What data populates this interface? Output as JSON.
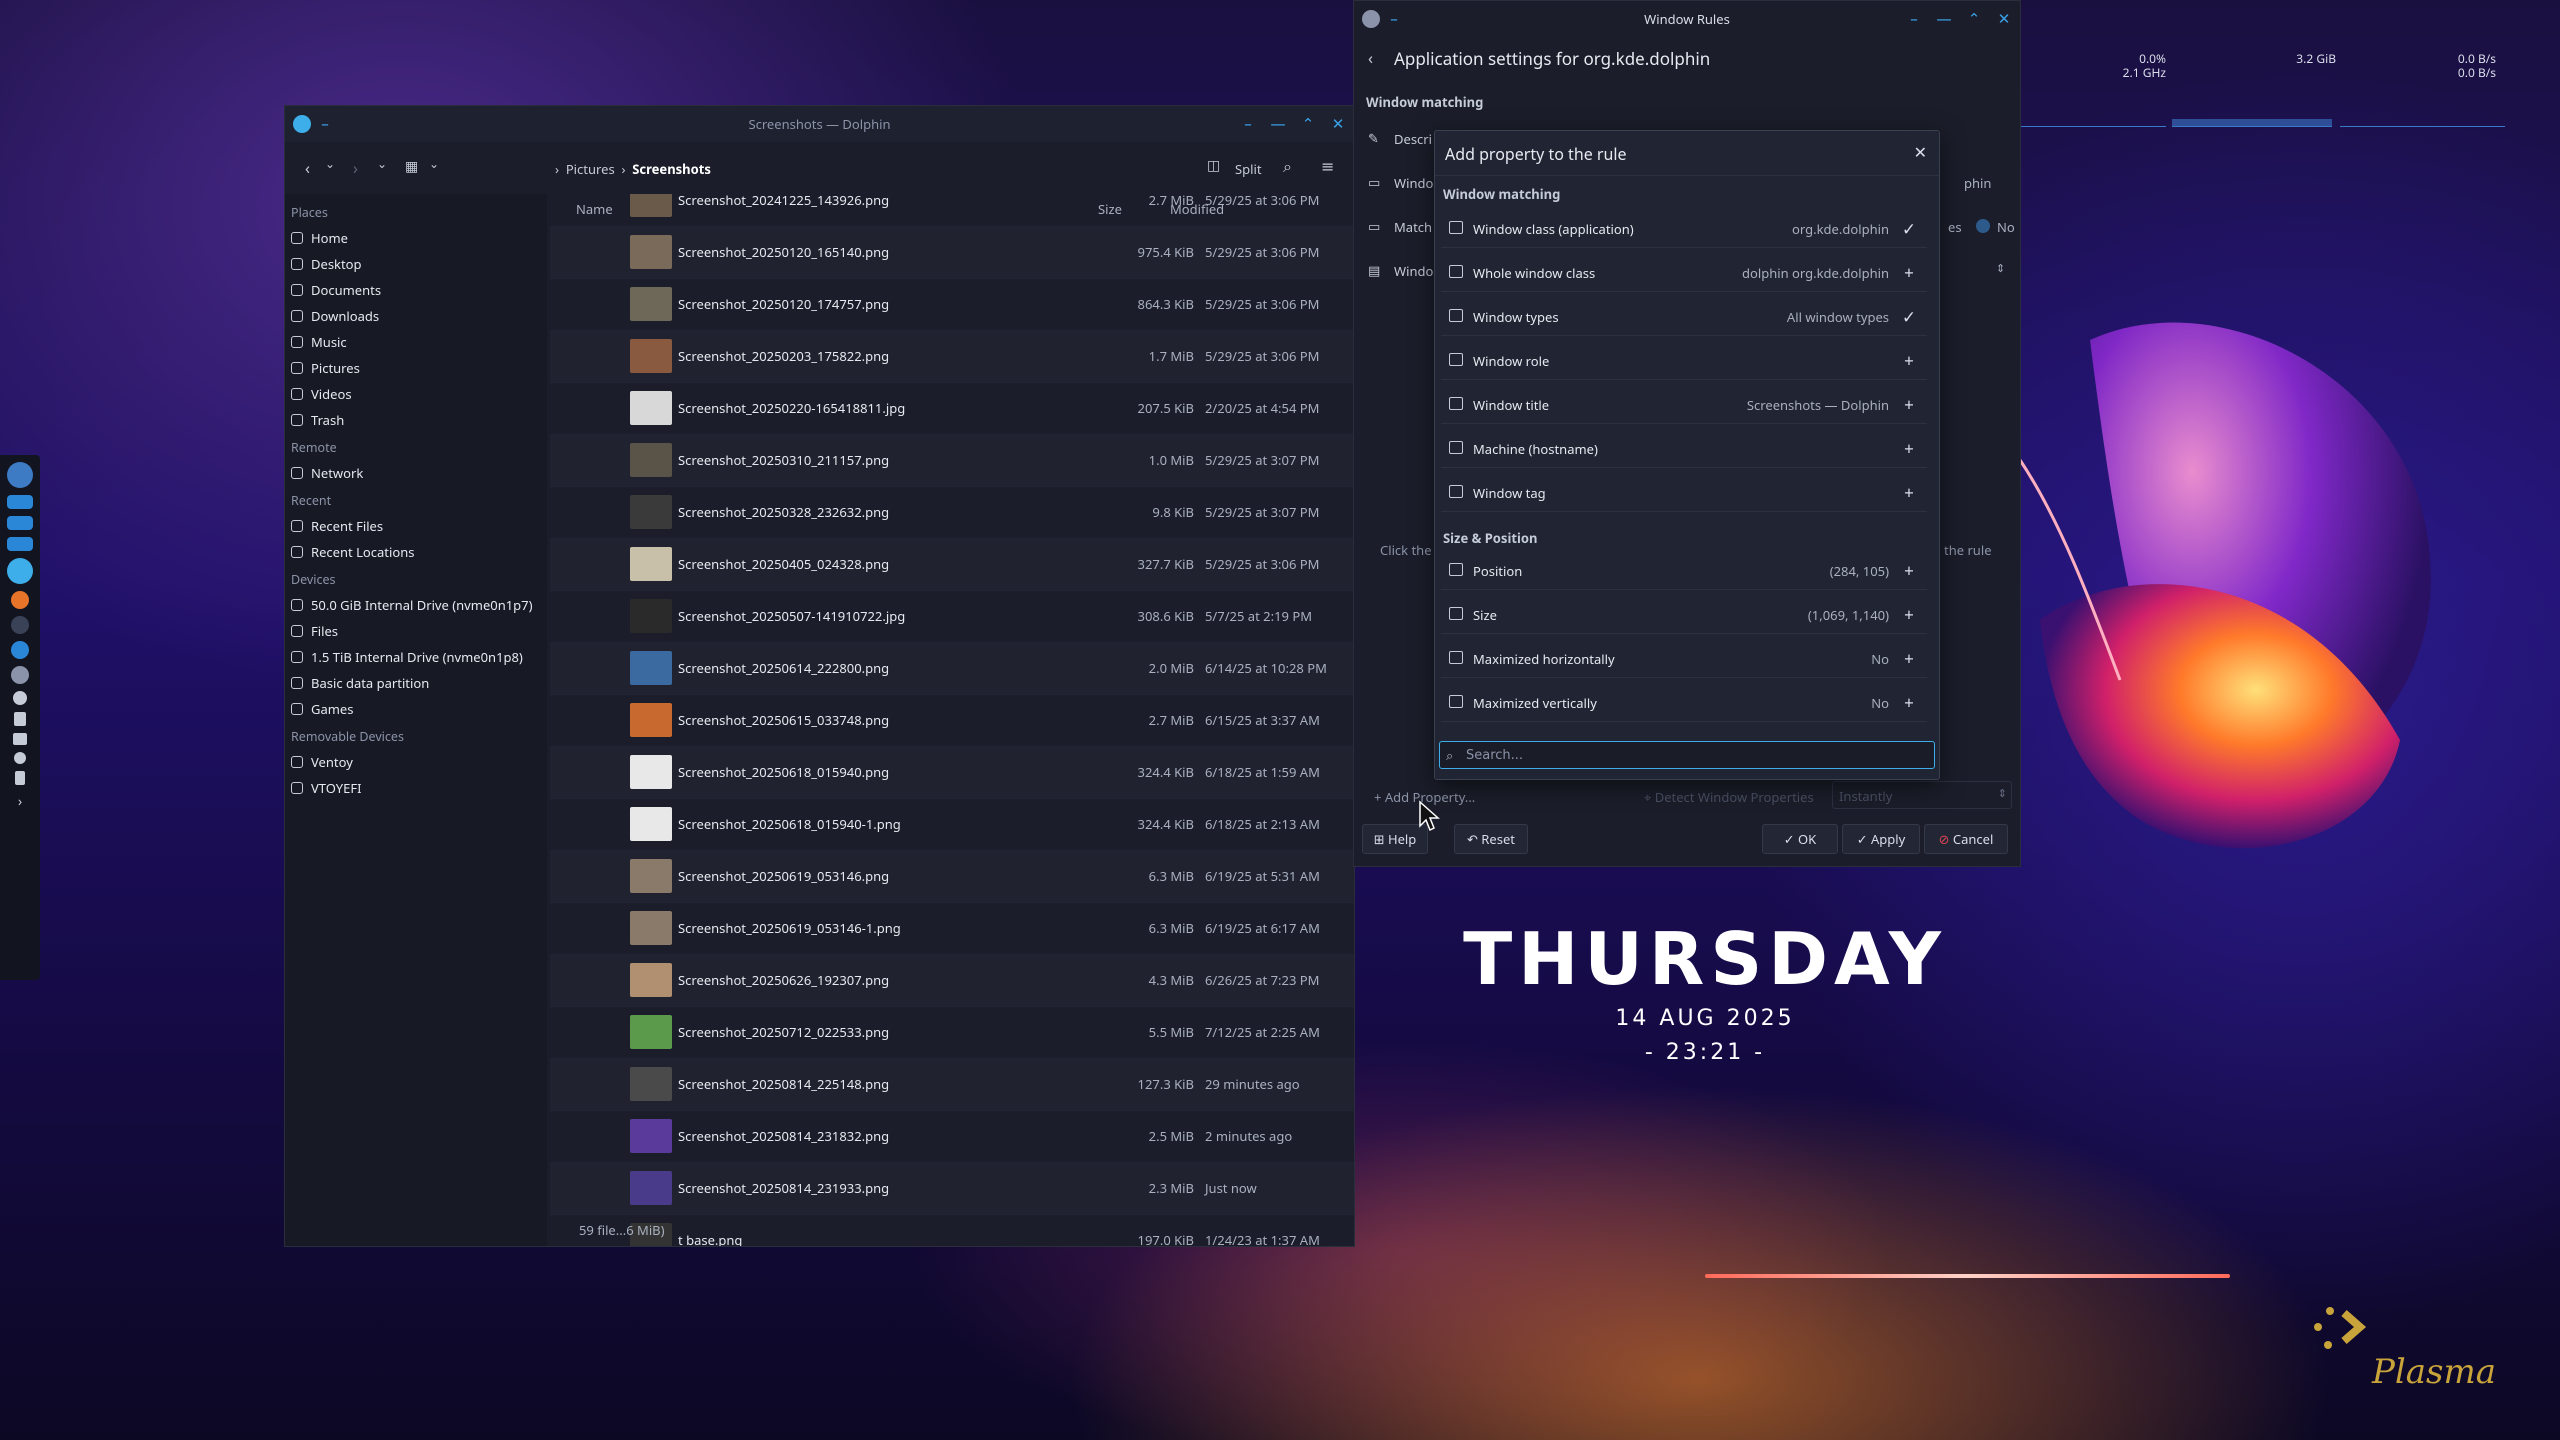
{
  "dolphin": {
    "title": "Screenshots — Dolphin",
    "split_label": "Split",
    "breadcrumb": [
      "Pictures",
      "Screenshots"
    ],
    "columns": {
      "name": "Name",
      "size": "Size",
      "modified": "Modified"
    },
    "places": [
      {
        "section": "Places",
        "items": [
          {
            "icon": "home-icon",
            "label": "Home"
          },
          {
            "icon": "desktop-icon",
            "label": "Desktop"
          },
          {
            "icon": "documents-icon",
            "label": "Documents"
          },
          {
            "icon": "downloads-icon",
            "label": "Downloads"
          },
          {
            "icon": "music-icon",
            "label": "Music"
          },
          {
            "icon": "pictures-icon",
            "label": "Pictures"
          },
          {
            "icon": "videos-icon",
            "label": "Videos"
          },
          {
            "icon": "trash-icon",
            "label": "Trash"
          }
        ]
      },
      {
        "section": "Remote",
        "items": [
          {
            "icon": "network-icon",
            "label": "Network"
          }
        ]
      },
      {
        "section": "Recent",
        "items": [
          {
            "icon": "recent-files-icon",
            "label": "Recent Files"
          },
          {
            "icon": "recent-locations-icon",
            "label": "Recent Locations"
          }
        ]
      },
      {
        "section": "Devices",
        "items": [
          {
            "icon": "drive-icon",
            "label": "50.0 GiB Internal Drive (nvme0n1p7)"
          },
          {
            "icon": "drive-icon",
            "label": "Files"
          },
          {
            "icon": "drive-icon",
            "label": "1.5 TiB Internal Drive (nvme0n1p8)"
          },
          {
            "icon": "drive-icon",
            "label": "Basic data partition"
          },
          {
            "icon": "drive-icon",
            "label": "Games"
          }
        ]
      },
      {
        "section": "Removable Devices",
        "items": [
          {
            "icon": "usb-icon",
            "label": "Ventoy"
          },
          {
            "icon": "usb-icon",
            "label": "VTOYEFI"
          }
        ]
      }
    ],
    "files": [
      {
        "name": "Screenshot_20241225_143926.png",
        "size": "2.7 MiB",
        "modified": "5/29/25 at 3:06 PM",
        "thumb": "#6a5a4a"
      },
      {
        "name": "Screenshot_20250120_165140.png",
        "size": "975.4 KiB",
        "modified": "5/29/25 at 3:06 PM",
        "thumb": "#7a6a5a"
      },
      {
        "name": "Screenshot_20250120_174757.png",
        "size": "864.3 KiB",
        "modified": "5/29/25 at 3:06 PM",
        "thumb": "#6e6858"
      },
      {
        "name": "Screenshot_20250203_175822.png",
        "size": "1.7 MiB",
        "modified": "5/29/25 at 3:06 PM",
        "thumb": "#8a5a40"
      },
      {
        "name": "Screenshot_20250220-165418811.jpg",
        "size": "207.5 KiB",
        "modified": "2/20/25 at 4:54 PM",
        "thumb": "#d8d8d8"
      },
      {
        "name": "Screenshot_20250310_211157.png",
        "size": "1.0 MiB",
        "modified": "5/29/25 at 3:07 PM",
        "thumb": "#5a5448"
      },
      {
        "name": "Screenshot_20250328_232632.png",
        "size": "9.8 KiB",
        "modified": "5/29/25 at 3:07 PM",
        "thumb": "#3a3a3a"
      },
      {
        "name": "Screenshot_20250405_024328.png",
        "size": "327.7 KiB",
        "modified": "5/29/25 at 3:06 PM",
        "thumb": "#c8c0a8"
      },
      {
        "name": "Screenshot_20250507-141910722.jpg",
        "size": "308.6 KiB",
        "modified": "5/7/25 at 2:19 PM",
        "thumb": "#2a2a2a"
      },
      {
        "name": "Screenshot_20250614_222800.png",
        "size": "2.0 MiB",
        "modified": "6/14/25 at 10:28 PM",
        "thumb": "#3a6aa0"
      },
      {
        "name": "Screenshot_20250615_033748.png",
        "size": "2.7 MiB",
        "modified": "6/15/25 at 3:37 AM",
        "thumb": "#c86a30"
      },
      {
        "name": "Screenshot_20250618_015940.png",
        "size": "324.4 KiB",
        "modified": "6/18/25 at 1:59 AM",
        "thumb": "#e8e8e8"
      },
      {
        "name": "Screenshot_20250618_015940-1.png",
        "size": "324.4 KiB",
        "modified": "6/18/25 at 2:13 AM",
        "thumb": "#e8e8e8"
      },
      {
        "name": "Screenshot_20250619_053146.png",
        "size": "6.3 MiB",
        "modified": "6/19/25 at 5:31 AM",
        "thumb": "#8a7a6a"
      },
      {
        "name": "Screenshot_20250619_053146-1.png",
        "size": "6.3 MiB",
        "modified": "6/19/25 at 6:17 AM",
        "thumb": "#8a7a6a"
      },
      {
        "name": "Screenshot_20250626_192307.png",
        "size": "4.3 MiB",
        "modified": "6/26/25 at 7:23 PM",
        "thumb": "#b09070"
      },
      {
        "name": "Screenshot_20250712_022533.png",
        "size": "5.5 MiB",
        "modified": "7/12/25 at 2:25 AM",
        "thumb": "#5a9a4a"
      },
      {
        "name": "Screenshot_20250814_225148.png",
        "size": "127.3 KiB",
        "modified": "29 minutes ago",
        "thumb": "#4a4a4a"
      },
      {
        "name": "Screenshot_20250814_231832.png",
        "size": "2.5 MiB",
        "modified": "2 minutes ago",
        "thumb": "#5a3a9a"
      },
      {
        "name": "Screenshot_20250814_231933.png",
        "size": "2.3 MiB",
        "modified": "Just now",
        "thumb": "#4a3a8a"
      },
      {
        "name": "t base.png",
        "size": "197.0 KiB",
        "modified": "1/24/23 at 1:37 AM",
        "thumb": "#333"
      }
    ],
    "status": "59 file...6 MiB)"
  },
  "rules": {
    "title": "Window Rules",
    "heading": "Application settings for org.kde.dolphin",
    "section": "Window matching",
    "bg_rows": [
      "Descri",
      "Windo",
      "Match",
      "Windo"
    ],
    "bg_right": {
      "value1": "phin",
      "value2": "es",
      "value3": "No"
    },
    "hint_left": "Click the",
    "hint_right": "the rule",
    "add_property": "Add Property...",
    "detect": "Detect Window Properties",
    "instantly": "Instantly",
    "buttons": {
      "help": "Help",
      "reset": "Reset",
      "ok": "OK",
      "apply": "Apply",
      "cancel": "Cancel"
    }
  },
  "popup": {
    "title": "Add property to the rule",
    "section_matching": "Window matching",
    "matching": [
      {
        "icon": "window-icon",
        "label": "Window class (application)",
        "value": "org.kde.dolphin",
        "action": "check"
      },
      {
        "icon": "window-icon",
        "label": "Whole window class",
        "value": "dolphin org.kde.dolphin",
        "action": "plus"
      },
      {
        "icon": "window-types-icon",
        "label": "Window types",
        "value": "All window types",
        "action": "check"
      },
      {
        "icon": "window-role-icon",
        "label": "Window role",
        "value": "",
        "action": "plus"
      },
      {
        "icon": "window-title-icon",
        "label": "Window title",
        "value": "Screenshots — Dolphin",
        "action": "plus"
      },
      {
        "icon": "monitor-icon",
        "label": "Machine (hostname)",
        "value": "",
        "action": "plus"
      },
      {
        "icon": "tag-icon",
        "label": "Window tag",
        "value": "",
        "action": "plus"
      }
    ],
    "section_size": "Size & Position",
    "size": [
      {
        "icon": "position-icon",
        "label": "Position",
        "value": "(284, 105)",
        "action": "plus"
      },
      {
        "icon": "size-icon",
        "label": "Size",
        "value": "(1,069, 1,140)",
        "action": "plus"
      },
      {
        "icon": "maximize-h-icon",
        "label": "Maximized horizontally",
        "value": "No",
        "action": "plus"
      },
      {
        "icon": "maximize-v-icon",
        "label": "Maximized vertically",
        "value": "No",
        "action": "plus"
      }
    ],
    "search_placeholder": "Search..."
  },
  "sysmon": {
    "cpu": "0.0%",
    "freq": "2.1 GHz",
    "mem": "3.2 GiB",
    "net_up": "0.0 B/s",
    "net_down": "0.0 B/s"
  },
  "clock": {
    "day": "THURSDAY",
    "date": "14 AUG 2025",
    "time": "- 23:21 -"
  },
  "plasma": {
    "label": "Plasma"
  },
  "colors": {
    "accent": "#3daee9",
    "window_bg": "#1b1e2a",
    "text": "#e6e9ef"
  }
}
